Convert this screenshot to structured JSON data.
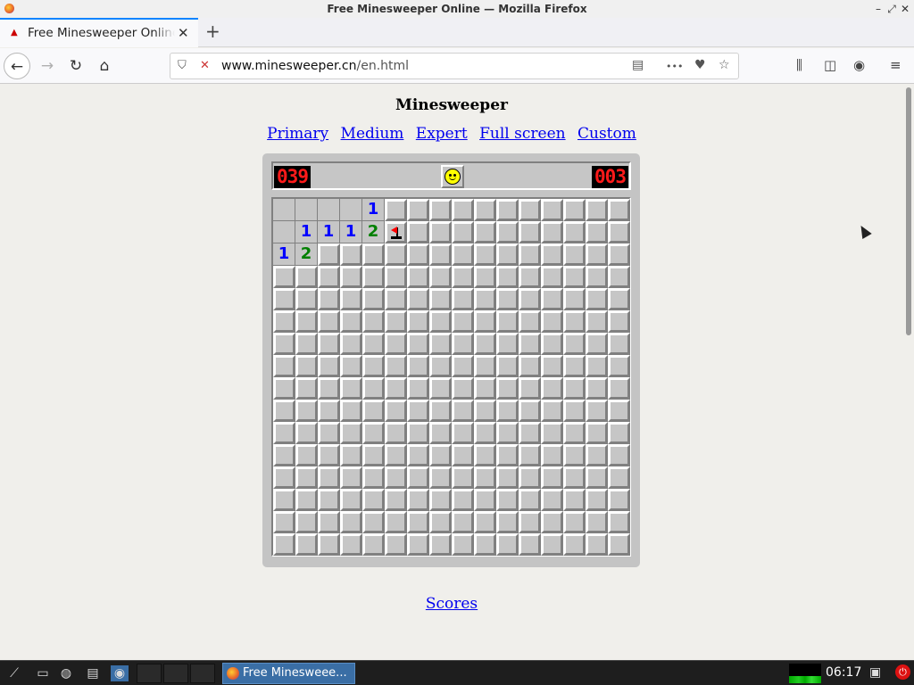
{
  "window": {
    "title": "Free Minesweeper Online — Mozilla Firefox",
    "minimize_glyph": "–",
    "maximize_glyph": "⤢",
    "close_glyph": "✕"
  },
  "tab": {
    "title": "Free Minesweeper Online",
    "close_glyph": "✕",
    "new_tab_glyph": "+"
  },
  "navbar": {
    "back_glyph": "←",
    "forward_glyph": "→",
    "reload_glyph": "↻",
    "home_glyph": "⌂",
    "url_host": "www.minesweeper.cn",
    "url_path": "/en.html",
    "reader_glyph": "▤",
    "more_glyph": "•••",
    "pocket_glyph": "♥",
    "bookmark_glyph": "☆",
    "library_glyph": "⫼",
    "sidebar_glyph": "◫",
    "account_glyph": "◉",
    "menu_glyph": "≡",
    "shield_glyph": "⛉",
    "lock_glyph": "🔓"
  },
  "page": {
    "heading": "Minesweeper",
    "levels": [
      "Primary",
      "Medium",
      "Expert",
      "Full screen",
      "Custom"
    ],
    "scores_link": "Scores"
  },
  "game": {
    "mines_counter": "039",
    "timer": "003",
    "face": "smile",
    "rows": 16,
    "cols": 16,
    "revealed": [
      {
        "r": 0,
        "c": 0,
        "v": ""
      },
      {
        "r": 0,
        "c": 1,
        "v": ""
      },
      {
        "r": 0,
        "c": 2,
        "v": ""
      },
      {
        "r": 0,
        "c": 3,
        "v": ""
      },
      {
        "r": 0,
        "c": 4,
        "v": "1"
      },
      {
        "r": 1,
        "c": 0,
        "v": ""
      },
      {
        "r": 1,
        "c": 1,
        "v": "1"
      },
      {
        "r": 1,
        "c": 2,
        "v": "1"
      },
      {
        "r": 1,
        "c": 3,
        "v": "1"
      },
      {
        "r": 1,
        "c": 4,
        "v": "2"
      },
      {
        "r": 2,
        "c": 0,
        "v": "1"
      },
      {
        "r": 2,
        "c": 1,
        "v": "2"
      }
    ],
    "flags": [
      {
        "r": 1,
        "c": 5
      }
    ]
  },
  "taskbar": {
    "task_label": "Free Minesweee...",
    "clock": "06:17"
  },
  "colors": {
    "accent_tab": "#0a84ff",
    "link": "#0000ee",
    "lcd_text": "#ff1a1a",
    "number_1": "#0000ff",
    "number_2": "#008000",
    "flag": "#ff0000",
    "taskbar_task": "#3a6ea5"
  }
}
